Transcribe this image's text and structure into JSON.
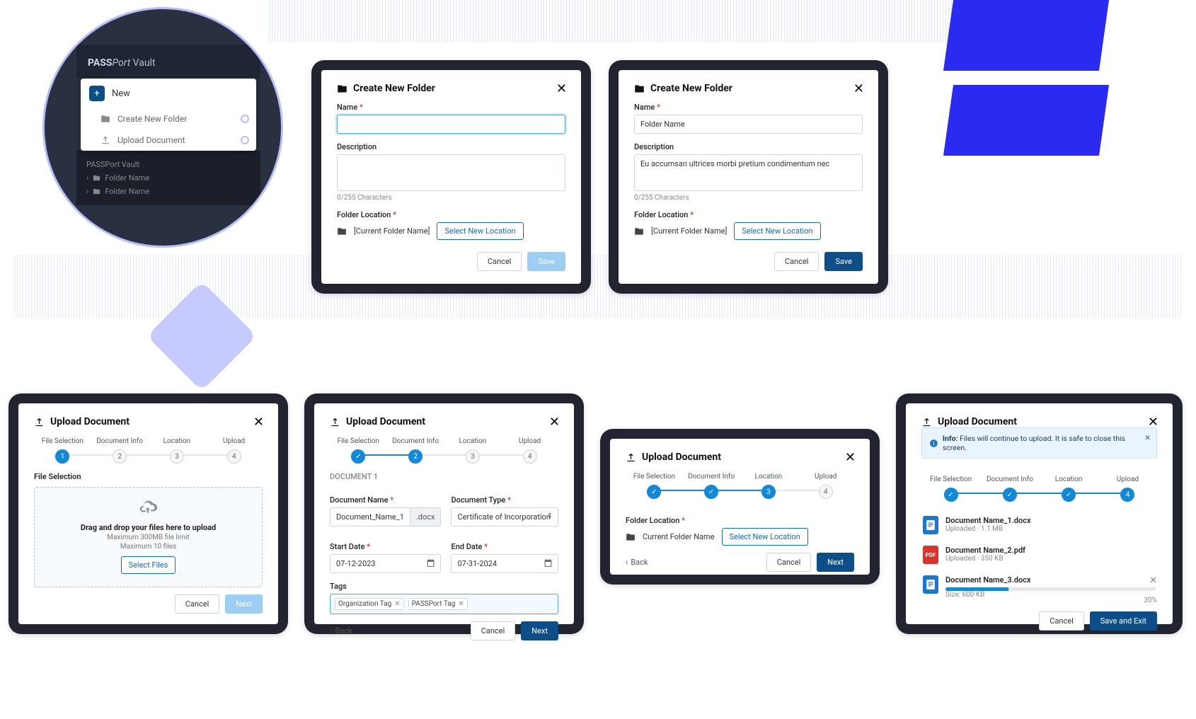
{
  "magnifier": {
    "appTitleBold": "PASS",
    "appTitleItalic": "Port",
    "appTitleRest": " Vault",
    "newLabel": "New",
    "createFolder": "Create New Folder",
    "uploadDoc": "Upload Document",
    "rootLabel": "PASSPort Vault",
    "folder1": "Folder Name",
    "folder2": "Folder Name"
  },
  "createFolder": {
    "title": "Create New Folder",
    "nameLabel": "Name",
    "descLabel": "Description",
    "charHint": "0/255 Characters",
    "locLabel": "Folder Location",
    "currentFolder": "[Current Folder Name]",
    "selectNewLoc": "Select New Location",
    "cancel": "Cancel",
    "save": "Save",
    "filled": {
      "name": "Folder Name",
      "desc": "Eu accumsan ultrices morbi pretium condimentum nec"
    }
  },
  "uploadDoc": {
    "title": "Upload Document",
    "steps": [
      "File Selection",
      "Document Info",
      "Location",
      "Upload"
    ],
    "step1": {
      "sectionLabel": "File Selection",
      "dzTitle": "Drag and drop your files here to upload",
      "dzSub1": "Maximum 300MB file limit",
      "dzSub2": "Maximum 10 files",
      "selectFiles": "Select Files",
      "cancel": "Cancel",
      "next": "Next"
    },
    "step2": {
      "docHeading": "DOCUMENT 1",
      "docNameLabel": "Document Name",
      "docNameValue": "Document_Name_1",
      "docExt": ".docx",
      "docTypeLabel": "Document Type",
      "docTypeValue": "Certificate of Incorporation",
      "startDateLabel": "Start Date",
      "startDateValue": "07-12-2023",
      "endDateLabel": "End Date",
      "endDateValue": "07-31-2024",
      "tagsLabel": "Tags",
      "tags": [
        "Organization Tag",
        "PASSPort Tag"
      ],
      "back": "Back",
      "cancel": "Cancel",
      "next": "Next"
    },
    "step3": {
      "locLabel": "Folder Location",
      "currentFolder": "Current Folder Name",
      "selectNewLoc": "Select New Location",
      "back": "Back",
      "cancel": "Cancel",
      "next": "Next"
    },
    "step4": {
      "infoBold": "Info:",
      "infoText": " Files will continue to upload. It is safe to close this screen.",
      "files": [
        {
          "name": "Document Name_1.docx",
          "meta": "Uploaded · 1.1 MB",
          "type": "docx",
          "progress": 100
        },
        {
          "name": "Document Name_2.pdf",
          "meta": "Uploaded · 350 KB",
          "type": "pdf",
          "progress": 100
        },
        {
          "name": "Document Name_3.docx",
          "meta": "Size: 600 KB",
          "type": "docx",
          "progress": 30,
          "pct": "30%"
        }
      ],
      "cancel": "Cancel",
      "saveExit": "Save and Exit"
    }
  }
}
